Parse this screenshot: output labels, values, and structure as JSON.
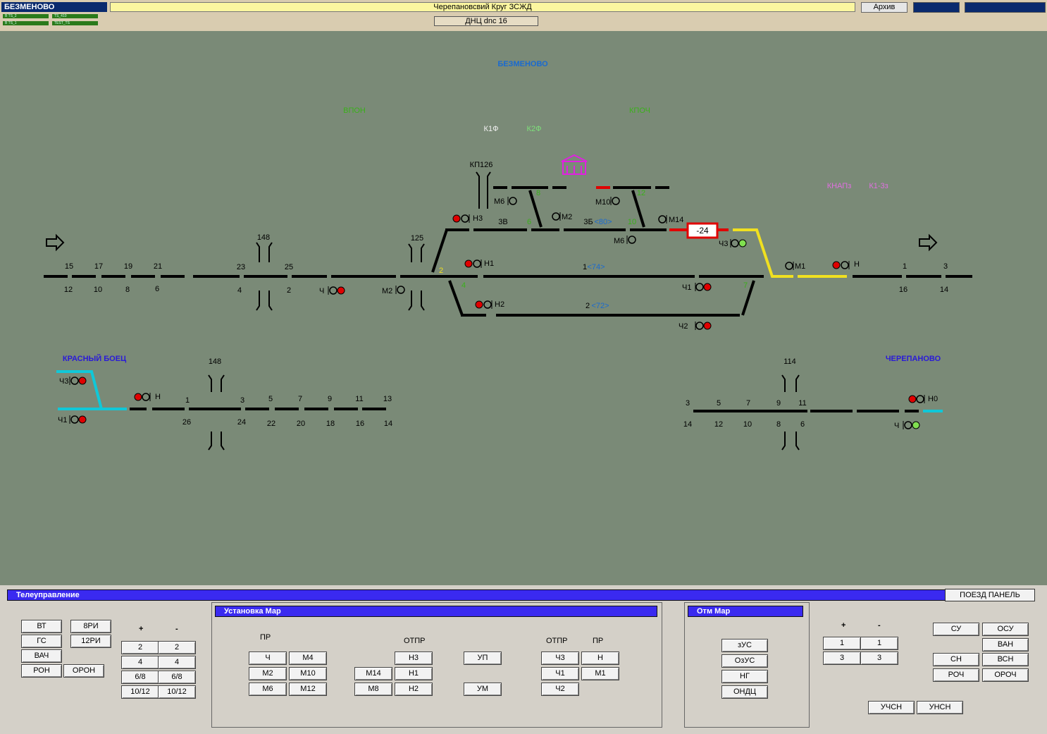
{
  "header": {
    "station": "БЕЗМЕНОВО",
    "ts_tags": [
      "B TS_2",
      "TS_410",
      "B TS_1",
      "TEST_TS"
    ],
    "title": "Черепановсвий Круг ЗСЖД",
    "archive_button": "Архив",
    "dnc": "ДНЦ dnc 16"
  },
  "scheme": {
    "station_title": "БЕЗМЕНОВО",
    "green_labels": [
      "ВПОН",
      "КПОЧ"
    ],
    "k1f": "К1Ф",
    "k2f": "К2Ф",
    "knap": "КНАПз",
    "k13": "К1-3з",
    "kp126": "КП126",
    "train_number": "-24",
    "left_station": "КРАСНЫЙ БОЕЦ",
    "right_station": "ЧЕРЕПАНОВО",
    "track_1": "1",
    "track_1_speed": "<74>",
    "track_2": "2",
    "track_2_speed": "<72>",
    "track_3v": "3В",
    "track_3b": "3Б",
    "track_3b_speed": "<80>",
    "signals": {
      "n3": "Н3",
      "m6a": "М6",
      "m2a": "М2",
      "m10": "М10",
      "m14": "М14",
      "m6b": "М6",
      "ch3": "Ч3",
      "n1": "Н1",
      "n2": "Н2",
      "m1": "М1",
      "n": "Н",
      "ch": "Ч",
      "m2b": "М2",
      "ch1": "Ч1",
      "ch2": "Ч2",
      "lch3": "Ч3",
      "lch1": "Ч1",
      "ln": "Н",
      "rn0": "Н0",
      "rch": "Ч"
    },
    "numbers": {
      "n148": "148",
      "n125": "125",
      "n148b": "148",
      "n114": "114",
      "top_left": [
        "15",
        "17",
        "19",
        "21",
        "23",
        "25"
      ],
      "bot_left": [
        "12",
        "10",
        "8",
        "6",
        "4",
        "2"
      ],
      "top_right": [
        "1",
        "3"
      ],
      "bot_right": [
        "16",
        "14"
      ],
      "ll_top": [
        "1",
        "3",
        "5",
        "7",
        "9",
        "11",
        "13"
      ],
      "ll_bot": [
        "26",
        "24",
        "22",
        "20",
        "18",
        "16",
        "14"
      ],
      "lr_top": [
        "3",
        "5",
        "7",
        "9",
        "11"
      ],
      "lr_bot": [
        "14",
        "12",
        "10",
        "8",
        "6"
      ],
      "sw_green": [
        "8",
        "6",
        "10",
        "12",
        "4",
        "7"
      ],
      "sw_yellow": "2"
    }
  },
  "panel": {
    "title": "Телеуправление",
    "poezd_panel": "ПОЕЗД ПАНЕЛЬ",
    "left_buttons": [
      "ВТ",
      "8РИ",
      "ГС",
      "12РИ",
      "ВАЧ",
      "РОН",
      "ОРОН"
    ],
    "plus": "+",
    "minus": "-",
    "plus_minus_left": [
      "2",
      "2",
      "4",
      "4",
      "6/8",
      "6/8",
      "10/12",
      "10/12"
    ],
    "route_set": {
      "title": "Установка Мар",
      "pr": "ПР",
      "otpr": "ОТПР",
      "otpr2": "ОТПР",
      "pr2": "ПР",
      "buttons": [
        "Ч",
        "М4",
        "М2",
        "М10",
        "М6",
        "М12",
        "Н3",
        "М14",
        "Н1",
        "М8",
        "Н2",
        "УП",
        "УМ",
        "Ч3",
        "Н",
        "Ч1",
        "М1",
        "Ч2"
      ]
    },
    "route_cancel": {
      "title": "Отм Мар",
      "buttons": [
        "зУС",
        "ОзУС",
        "НГ",
        "ОНДЦ"
      ]
    },
    "plus_minus_right": [
      "1",
      "1",
      "3",
      "3"
    ],
    "right_buttons": [
      "СУ",
      "ОСУ",
      "ВАН",
      "СН",
      "ВСН",
      "РОЧ",
      "ОРОЧ",
      "УЧСН",
      "УНСН"
    ]
  },
  "colors": {
    "background": "#7a8a77",
    "track": "#000000",
    "track_occupied": "#e00000",
    "route_set": "#f0e020",
    "cyan_track": "#10c8d8",
    "signal_red": "#e00000",
    "signal_green": "#80e050",
    "station_blue": "#1a6ad0",
    "station_violet": "#2a1ad8",
    "magenta": "#e020e0"
  }
}
